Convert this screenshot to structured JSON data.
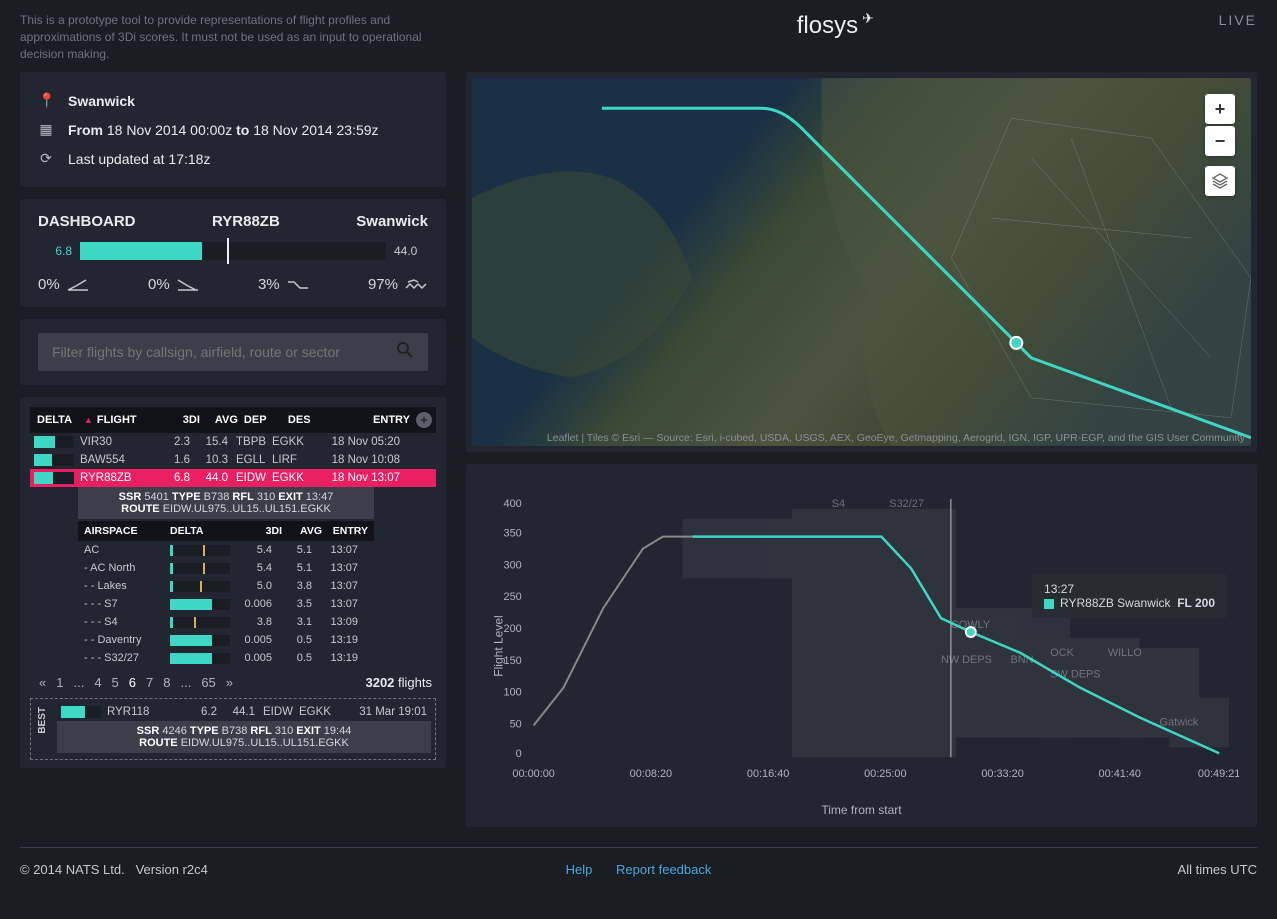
{
  "disclaimer": "This is a prototype tool to provide representations of flight profiles and approximations of 3Di scores. It must not be used as an input to operational decision making.",
  "brand": "flosys",
  "live_label": "LIVE",
  "info": {
    "location": "Swanwick",
    "from_label": "From",
    "from_value": "18 Nov 2014 00:00z",
    "to_label": "to",
    "to_value": "18 Nov 2014 23:59z",
    "updated": "Last updated at 17:18z"
  },
  "dashboard": {
    "dash_label": "DASHBOARD",
    "callsign": "RYR88ZB",
    "region": "Swanwick",
    "delta": "6.8",
    "avg": "44.0",
    "pcts": [
      {
        "val": "0%",
        "icon": "takeoff"
      },
      {
        "val": "0%",
        "icon": "landing"
      },
      {
        "val": "3%",
        "icon": "descent"
      },
      {
        "val": "97%",
        "icon": "cruise"
      }
    ]
  },
  "search_placeholder": "Filter flights by callsign, airfield, route or sector",
  "table": {
    "headers": {
      "delta": "DELTA",
      "flight": "FLIGHT",
      "tdi": "3DI",
      "avg": "AVG",
      "dep": "DEP",
      "des": "DES",
      "entry": "ENTRY"
    },
    "rows": [
      {
        "bar": 52,
        "flight": "VIR30",
        "tdi": "2.3",
        "avg": "15.4",
        "dep": "TBPB",
        "des": "EGKK",
        "entry": "18 Nov 05:20",
        "sel": false
      },
      {
        "bar": 45,
        "flight": "BAW554",
        "tdi": "1.6",
        "avg": "10.3",
        "dep": "EGLL",
        "des": "LIRF",
        "entry": "18 Nov 10:08",
        "sel": false
      },
      {
        "bar": 48,
        "flight": "RYR88ZB",
        "tdi": "6.8",
        "avg": "44.0",
        "dep": "EIDW",
        "des": "EGKK",
        "entry": "18 Nov 13:07",
        "sel": true
      }
    ],
    "detail": {
      "line1": "SSR 5401 TYPE B738 RFL 310 EXIT 13:47",
      "line2": "ROUTE EIDW.UL975..UL15..UL151.EGKK"
    },
    "airspace_headers": {
      "airspace": "AIRSPACE",
      "delta": "DELTA",
      "tdi": "3DI",
      "avg": "AVG",
      "entry": "ENTRY"
    },
    "airspace": [
      {
        "name": "AC",
        "bar": 5,
        "marker": 55,
        "tdi": "5.4",
        "avg": "5.1",
        "entry": "13:07"
      },
      {
        "name": "- AC North",
        "bar": 5,
        "marker": 55,
        "tdi": "5.4",
        "avg": "5.1",
        "entry": "13:07"
      },
      {
        "name": "- - Lakes",
        "bar": 5,
        "marker": 50,
        "tdi": "5.0",
        "avg": "3.8",
        "entry": "13:07"
      },
      {
        "name": "- - - S7",
        "bar": 70,
        "marker": 0,
        "tdi": "0.006",
        "avg": "3.5",
        "entry": "13:07"
      },
      {
        "name": "- - - S4",
        "bar": 5,
        "marker": 40,
        "tdi": "3.8",
        "avg": "3.1",
        "entry": "13:09"
      },
      {
        "name": "- - Daventry",
        "bar": 70,
        "marker": 0,
        "tdi": "0.005",
        "avg": "0.5",
        "entry": "13:19"
      },
      {
        "name": "- - - S32/27",
        "bar": 70,
        "marker": 0,
        "tdi": "0.005",
        "avg": "0.5",
        "entry": "13:19"
      }
    ],
    "pager": [
      "«",
      "1",
      "...",
      "4",
      "5",
      "6",
      "7",
      "8",
      "...",
      "65",
      "»"
    ],
    "pager_current": "6",
    "count_num": "3202",
    "count_label": "flights"
  },
  "best": {
    "label": "BEST",
    "row": {
      "bar": 60,
      "flight": "RYR118",
      "tdi": "6.2",
      "avg": "44.1",
      "dep": "EIDW",
      "des": "EGKK",
      "entry": "31 Mar 19:01"
    },
    "detail1": "SSR 4246 TYPE B738 RFL 310 EXIT 19:44",
    "detail2": "ROUTE EIDW.UL975..UL15..UL151.EGKK"
  },
  "map": {
    "attribution": "Leaflet | Tiles © Esri — Source: Esri, i-cubed, USDA, USGS, AEX, GeoEye, Getmapping, Aerogrid, IGN, IGP, UPR-EGP, and the GIS User Community",
    "zoom_in": "+",
    "zoom_out": "−"
  },
  "chart": {
    "ylabel": "Flight Level",
    "xlabel": "Time from start",
    "tooltip_time": "13:27",
    "tooltip_callsign": "RYR88ZB Swanwick",
    "tooltip_fl": "FL 200",
    "sector_labels": [
      "S4",
      "S32/27",
      "COWLY",
      "NW DEPS",
      "BNN",
      "OCK",
      "WILLO",
      "SW DEPS",
      "Gatwick"
    ],
    "x_ticks": [
      "00:00:00",
      "00:08:20",
      "00:16:40",
      "00:25:00",
      "00:33:20",
      "00:41:40",
      "00:49:21"
    ],
    "y_ticks": [
      "0",
      "50",
      "100",
      "150",
      "200",
      "250",
      "300",
      "350",
      "400"
    ]
  },
  "chart_data": {
    "type": "line",
    "title": "",
    "xlabel": "Time from start",
    "ylabel": "Flight Level",
    "ylim": [
      0,
      400
    ],
    "x": [
      "00:00:00",
      "00:02:00",
      "00:04:00",
      "00:06:00",
      "00:08:20",
      "00:10:00",
      "00:16:40",
      "00:25:00",
      "00:27:00",
      "00:29:00",
      "00:33:20",
      "00:37:00",
      "00:41:40",
      "00:45:00",
      "00:49:21"
    ],
    "series": [
      {
        "name": "RYR88ZB Swanwick",
        "values": [
          50,
          120,
          200,
          290,
          340,
          350,
          350,
          350,
          310,
          240,
          200,
          170,
          110,
          60,
          0
        ]
      }
    ],
    "marker": {
      "x": "00:29:00",
      "y": 200,
      "label": "13:27 FL 200"
    }
  },
  "footer": {
    "copyright": "© 2014 NATS Ltd.",
    "version": "Version r2c4",
    "help": "Help",
    "feedback": "Report feedback",
    "tz": "All times UTC"
  }
}
